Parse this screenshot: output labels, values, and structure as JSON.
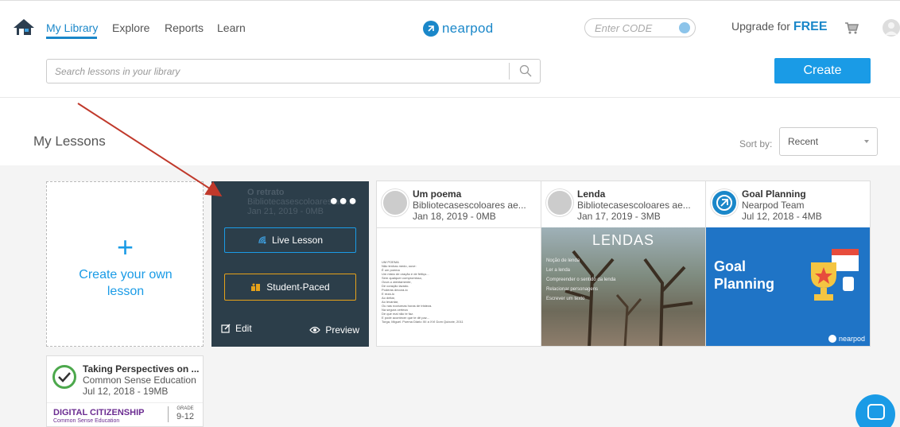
{
  "nav": {
    "links": [
      "My Library",
      "Explore",
      "Reports",
      "Learn"
    ],
    "logo": "nearpod",
    "code_placeholder": "Enter CODE",
    "upgrade_prefix": "Upgrade for",
    "upgrade_emph": "FREE"
  },
  "search": {
    "placeholder": "Search lessons in your library"
  },
  "toolbar": {
    "create_label": "Create"
  },
  "section": {
    "title": "My Lessons",
    "sort_label": "Sort by:",
    "sort_value": "Recent"
  },
  "create_card": {
    "label": "Create your own lesson"
  },
  "hover_card": {
    "dim_lines": [
      "O retrato",
      "Bibliotecasescoloares ae...",
      "Jan 21, 2019 - 0MB"
    ],
    "live_label": "Live Lesson",
    "student_label": "Student-Paced",
    "edit_label": "Edit",
    "preview_label": "Preview"
  },
  "lessons": [
    {
      "title": "Um poema",
      "author": "Bibliotecasescoloares ae...",
      "meta": "Jan 18, 2019 - 0MB"
    },
    {
      "title": "Lenda",
      "author": "Bibliotecasescoloares ae...",
      "meta": "Jan 17, 2019 - 3MB"
    },
    {
      "title": "Goal Planning",
      "author": "Nearpod Team",
      "meta": "Jul 12, 2018 - 4MB"
    },
    {
      "title": "Taking Perspectives on ...",
      "author": "Common Sense Education",
      "meta": "Jul 12, 2018 - 19MB"
    }
  ],
  "poem_doc": [
    "UM POEMA",
    "Não tenhas medo, ouve:",
    "É um poema",
    "Um misto de oração e de feitiço...",
    "Sem qualquer compromisso,",
    "Ouve-o atentamente,",
    "De coração lavado.",
    "Poderás decorá-lo",
    "E rezá-lo",
    "Ao deitar,",
    "Ao levantar,",
    "Ou nas nocturnas horas de tristeza.",
    "Na segura certeza",
    "De que mal não te faz.",
    "E pode acontecer que te dê paz...",
    "Torga, Miguel. Poema Diário XII a XVI Dom Quixote, 2011"
  ],
  "lenda_thumb": {
    "title": "LENDAS",
    "bullets": [
      "Noção de lenda",
      "Ler a lenda",
      "Compreender o sentido da lenda",
      "Relacionar personagens",
      "Escrever um texto"
    ]
  },
  "goal_thumb": {
    "title": "Goal Planning",
    "brand": "nearpod"
  },
  "dc_thumb": {
    "title": "DIGITAL CITIZENSHIP",
    "sub": "Common Sense Education",
    "grade_label": "GRADE",
    "grade": "9-12"
  },
  "colors": {
    "accent": "#1a9be6",
    "nearpod_blue": "#1a87c9",
    "arrow": "#c0392b",
    "student_paced": "#e6a21a"
  }
}
